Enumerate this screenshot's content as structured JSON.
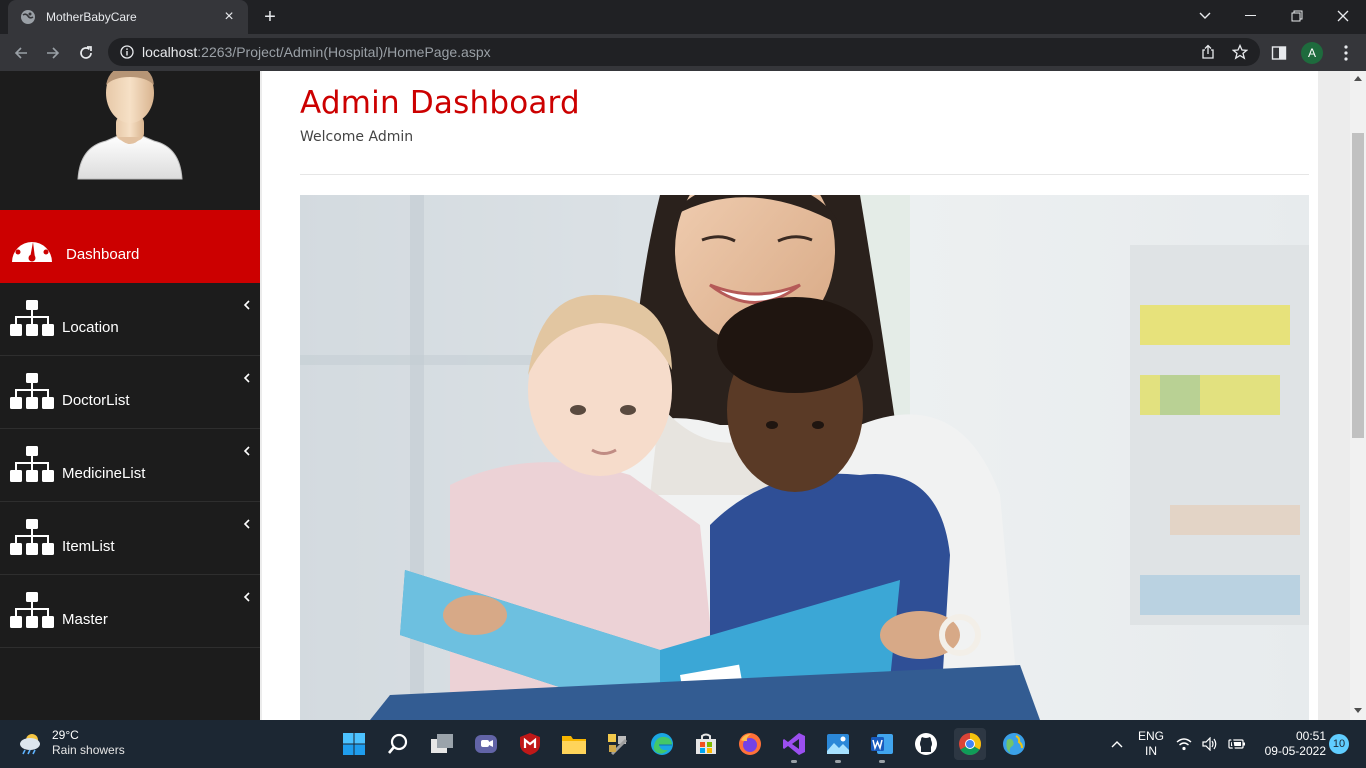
{
  "browser": {
    "tab_title": "MotherBabyCare",
    "url_host": "localhost",
    "url_rest": ":2263/Project/Admin(Hospital)/HomePage.aspx",
    "new_tab_glyph": "+",
    "close_tab_glyph": "×",
    "profile_initial": "A"
  },
  "sidebar": {
    "items": [
      {
        "label": "Dashboard",
        "icon": "speedometer-icon",
        "active": true
      },
      {
        "label": "Location",
        "icon": "sitemap-icon",
        "active": false
      },
      {
        "label": "DoctorList",
        "icon": "sitemap-icon",
        "active": false
      },
      {
        "label": "MedicineList",
        "icon": "sitemap-icon",
        "active": false
      },
      {
        "label": "ItemList",
        "icon": "sitemap-icon",
        "active": false
      },
      {
        "label": "Master",
        "icon": "sitemap-icon",
        "active": false
      }
    ]
  },
  "main": {
    "title": "Admin Dashboard",
    "welcome": "Welcome Admin"
  },
  "taskbar": {
    "weather_temp": "29°C",
    "weather_desc": "Rain showers",
    "lang_1": "ENG",
    "lang_2": "IN",
    "time": "00:51",
    "date": "09-05-2022",
    "notifications": "10"
  },
  "colors": {
    "accent": "#cc0000",
    "sidebar_bg": "#1c1c1c",
    "taskbar_bg": "#1c2733"
  }
}
